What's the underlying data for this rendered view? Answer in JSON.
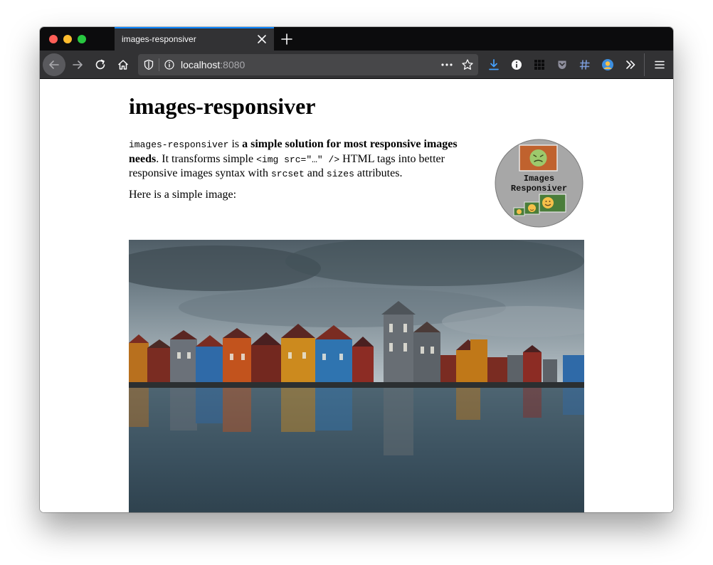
{
  "browser": {
    "tab_title": "images-responsiver",
    "url_host": "localhost",
    "url_port": ":8080"
  },
  "page": {
    "title": "images-responsiver",
    "intro": {
      "code_name": "images-responsiver",
      "text_is": " is ",
      "bold_text_1": "a simple solution for most responsive images",
      "bold_text_2": "needs",
      "text_2": ". It transforms simple ",
      "code_img": "<img src=\"…\" />",
      "text_3": " HTML tags into better responsive images syntax with ",
      "code_srcset": "srcset",
      "text_and": " and ",
      "code_sizes": "sizes",
      "text_4": " attributes."
    },
    "second_paragraph": "Here is a simple image:",
    "logo": {
      "line1": "Images",
      "line2": "Responsiver"
    }
  },
  "colors": {
    "tab_accent": "#0a84ff",
    "download_icon": "#45a1ff",
    "logo_circle": "#a7a7a7",
    "logo_top_square": "#c0622e",
    "logo_small_frames": "#4a7d3a"
  },
  "icons": [
    "back-arrow-icon",
    "forward-arrow-icon",
    "reload-icon",
    "home-icon",
    "shield-icon",
    "info-icon",
    "more-dots-icon",
    "star-icon",
    "download-icon",
    "info-circle-icon",
    "grid-icon",
    "pocket-icon",
    "puzzle-icon",
    "avatar-icon",
    "overflow-icon",
    "menu-icon",
    "close-icon",
    "plus-icon"
  ]
}
